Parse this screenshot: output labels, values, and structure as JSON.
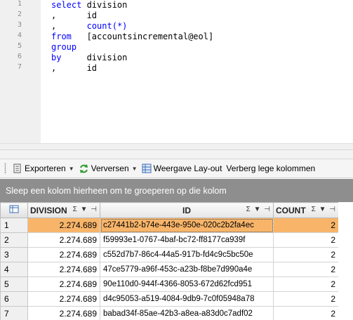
{
  "editor": {
    "lines": [
      {
        "num": "1",
        "kw": "select",
        "rest": " division",
        "fn": ""
      },
      {
        "num": "2",
        "kw": ",",
        "rest": "      id",
        "fn": ""
      },
      {
        "num": "3",
        "kw": ",",
        "rest": "      ",
        "fn": "count(*)"
      },
      {
        "num": "4",
        "kw": "from",
        "rest": "   [accountsincremental@eol]",
        "fn": ""
      },
      {
        "num": "5",
        "kw": "group",
        "rest": "",
        "fn": ""
      },
      {
        "num": "6",
        "kw": "by",
        "rest": "     division",
        "fn": ""
      },
      {
        "num": "7",
        "kw": ",",
        "rest": "      id",
        "fn": ""
      }
    ]
  },
  "toolbar": {
    "export_label": "Exporteren",
    "refresh_label": "Verversen",
    "layout_label": "Weergave Lay-out",
    "hide_empty_label": "Verberg lege kolommen"
  },
  "group_panel": {
    "text": "Sleep een kolom hierheen om te groeperen op die kolom"
  },
  "grid": {
    "columns": [
      {
        "label": "DIVISION",
        "icons": "Σ ▼ ⊣"
      },
      {
        "label": "ID",
        "icons": "Σ ▼ ⊣"
      },
      {
        "label": "COUNT",
        "icons": "Σ ▼ ⊣"
      }
    ],
    "rows": [
      {
        "n": "1",
        "division": "2.274.689",
        "id": "c27441b2-b74e-443e-950e-020c2b2fa4ec",
        "count": "2",
        "selected": true
      },
      {
        "n": "2",
        "division": "2.274.689",
        "id": "f59993e1-0767-4baf-bc72-ff8177ca939f",
        "count": "2"
      },
      {
        "n": "3",
        "division": "2.274.689",
        "id": "c552d7b7-86c4-44a5-917b-fd4c9c5bc50e",
        "count": "2"
      },
      {
        "n": "4",
        "division": "2.274.689",
        "id": "47ce5779-a96f-453c-a23b-f8be7d990a4e",
        "count": "2"
      },
      {
        "n": "5",
        "division": "2.274.689",
        "id": "90e110d0-944f-4366-8053-672d62fcd951",
        "count": "2"
      },
      {
        "n": "6",
        "division": "2.274.689",
        "id": "d4c95053-a519-4084-9db9-7c0f05948a78",
        "count": "2"
      },
      {
        "n": "7",
        "division": "2.274.689",
        "id": "babad34f-85ae-42b3-a8ea-a83d0c7adf02",
        "count": "2"
      }
    ]
  },
  "colors": {
    "keyword": "#0000ff",
    "selected_row": "#f8b56a",
    "group_panel": "#8e8e8e"
  }
}
